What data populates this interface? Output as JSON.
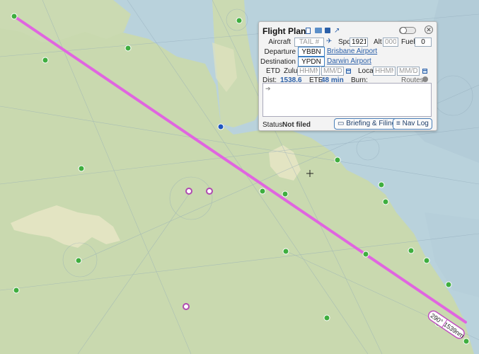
{
  "colors": {
    "route": "#e065e0",
    "airport_green": "#3fae3f",
    "airport_purple": "#c060c0",
    "airport_blue": "#1f56c0",
    "water": "#b9d2dc",
    "land": "#c8d8ae"
  },
  "map": {
    "route_label_course": "290°",
    "route_label_distance": "1539nm",
    "icons": [
      "green-airport-icon",
      "purple-airport-icon",
      "blue-airport-icon",
      "crosshair-icon"
    ]
  },
  "panel": {
    "title": "Flight Plan",
    "toolbar_icons": [
      "new-file-icon",
      "open-folder-icon",
      "save-icon",
      "share-icon"
    ],
    "aircraft_label": "Aircraft",
    "aircraft_placeholder": "TAIL #",
    "spd_label": "Spd",
    "spd_value": "1921",
    "alt_label": "Alt",
    "alt_placeholder": "000",
    "fuel_label": "Fuel",
    "fuel_value": "0",
    "departure_label": "Departure",
    "departure_code": "YBBN",
    "departure_name": "Brisbane Airport",
    "destination_label": "Destination",
    "destination_code": "YPDN",
    "destination_name": "Darwin Airport",
    "etd_label": "ETD",
    "zulu_label": "Zulu",
    "time_placeholder": "HHMM",
    "date_placeholder": "MM/DD",
    "local_label": "Local",
    "dist_label": "Dist:",
    "dist_value": "1538.6",
    "ete_label": "ETE:",
    "ete_value": "48 min",
    "burn_label": "Burn:",
    "routes_label": "Routes",
    "routes_arrow": "➔",
    "status_label": "Status:",
    "status_value": "Not filed",
    "briefing_button": "Briefing & Filing",
    "navlog_button": "Nav Log",
    "close_symbol": "✕"
  }
}
